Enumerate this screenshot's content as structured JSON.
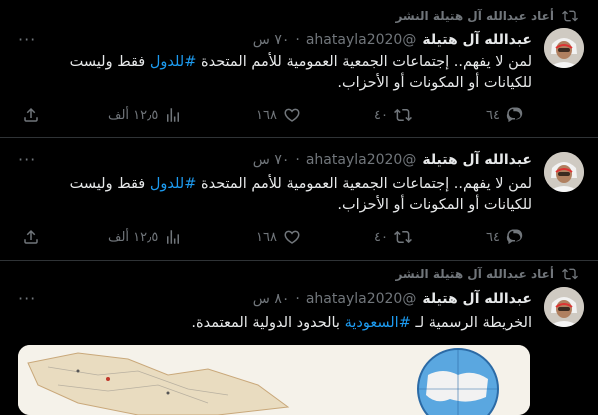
{
  "tweets": [
    {
      "retweet_label": "أعاد عبدالله آل هتيلة النشر",
      "name": "عبدالله آل هتيلة",
      "handle": "@ahatayla2020",
      "time": "٧٠ س",
      "text_before": "لمن لا يفهم.. إجتماعات الجمعية العمومية للأمم المتحدة ",
      "hashtag": "#للدول",
      "text_after": " فقط وليست للكيانات أو المكونات أو الأحزاب.",
      "replies": "٦٤",
      "retweets": "٤٠",
      "likes": "١٦٨",
      "views": "١٢٫٥ ألف"
    },
    {
      "name": "عبدالله آل هتيلة",
      "handle": "@ahatayla2020",
      "time": "٧٠ س",
      "text_before": "لمن لا يفهم.. إجتماعات الجمعية العمومية للأمم المتحدة ",
      "hashtag": "#للدول",
      "text_after": " فقط وليست للكيانات أو المكونات أو الأحزاب.",
      "replies": "٦٤",
      "retweets": "٤٠",
      "likes": "١٦٨",
      "views": "١٢٫٥ ألف"
    },
    {
      "retweet_label": "أعاد عبدالله آل هتيلة النشر",
      "name": "عبدالله آل هتيلة",
      "handle": "@ahatayla2020",
      "time": "٨٠ س",
      "text_before": "الخريطة الرسمية لـ ",
      "hashtag": "#السعودية",
      "text_after": " بالحدود الدولية المعتمدة."
    }
  ],
  "more_label": "···",
  "colors": {
    "accent": "#1d9bf0",
    "muted": "#71767b",
    "text": "#e7e9ea",
    "divider": "#2f3336"
  }
}
